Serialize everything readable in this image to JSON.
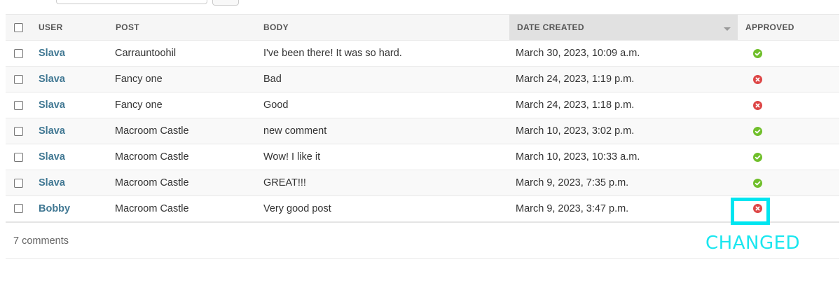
{
  "search": {
    "input_value": "",
    "button_label": ""
  },
  "table": {
    "columns": {
      "user": "USER",
      "post": "POST",
      "body": "BODY",
      "date_created": "DATE CREATED",
      "approved": "APPROVED"
    },
    "sorted_column": "date_created",
    "sort_direction": "descending",
    "rows": [
      {
        "user": "Slava",
        "post": "Carrauntoohil",
        "body": "I've been there! It was so hard.",
        "date": "March 30, 2023, 10:09 a.m.",
        "approved": true
      },
      {
        "user": "Slava",
        "post": "Fancy one",
        "body": "Bad",
        "date": "March 24, 2023, 1:19 p.m.",
        "approved": false
      },
      {
        "user": "Slava",
        "post": "Fancy one",
        "body": "Good",
        "date": "March 24, 2023, 1:18 p.m.",
        "approved": false
      },
      {
        "user": "Slava",
        "post": "Macroom Castle",
        "body": "new comment",
        "date": "March 10, 2023, 3:02 p.m.",
        "approved": true
      },
      {
        "user": "Slava",
        "post": "Macroom Castle",
        "body": "Wow! I like it",
        "date": "March 10, 2023, 10:33 a.m.",
        "approved": true
      },
      {
        "user": "Slava",
        "post": "Macroom Castle",
        "body": "GREAT!!!",
        "date": "March 9, 2023, 7:35 p.m.",
        "approved": true
      },
      {
        "user": "Bobby",
        "post": "Macroom Castle",
        "body": "Very good post",
        "date": "March 9, 2023, 3:47 p.m.",
        "approved": false
      }
    ]
  },
  "paginator": {
    "count_text": "7 comments"
  },
  "annotation": {
    "label": "CHANGED",
    "color": "#00e5f0"
  },
  "colors": {
    "link": "#417893",
    "approved_yes": "#70bf2b",
    "approved_no": "#dd4646"
  },
  "icons": {
    "approved_yes": "check-circle-icon",
    "approved_no": "x-circle-icon"
  }
}
